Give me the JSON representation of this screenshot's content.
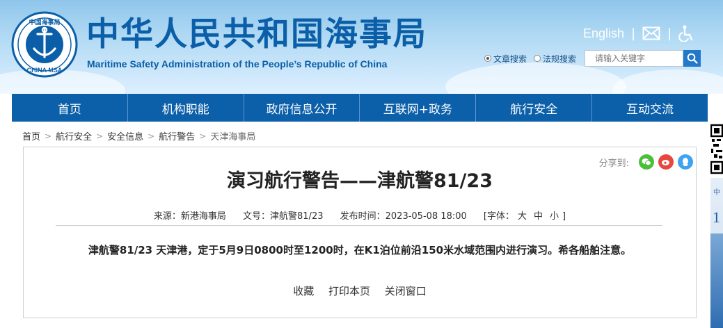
{
  "header": {
    "emblem_top_text": "中国海事局",
    "emblem_bottom_text": "CHINA MSA",
    "title": "中华人民共和国海事局",
    "subtitle": "Maritime Safety Administration of the People’s Republic of China",
    "english_link": "English",
    "icons": [
      "mail-icon",
      "accessibility-icon"
    ],
    "search": {
      "options": [
        {
          "label": "文章搜索",
          "selected": true
        },
        {
          "label": "法规搜索",
          "selected": false
        }
      ],
      "placeholder": "请输入关键字"
    }
  },
  "nav": {
    "items": [
      "首页",
      "机构职能",
      "政府信息公开",
      "互联网+政务",
      "航行安全",
      "互动交流"
    ]
  },
  "breadcrumb": [
    "首页",
    "航行安全",
    "安全信息",
    "航行警告",
    "天津海事局"
  ],
  "article": {
    "share_label": "分享到:",
    "share_icons": [
      "wechat-icon",
      "weibo-icon",
      "qq-icon"
    ],
    "title": "演习航行警告——津航警81/23",
    "source": "来源：新港海事局",
    "doc_no": "文号：津航警81/23",
    "published": "发布时间：2023-05-08 18:00",
    "font_size_label": "[字体：",
    "font_sizes": [
      "大",
      "中",
      "小"
    ],
    "font_size_close": "]",
    "body": "津航警81/23 天津港，定于5月9日0800时至1200时，在K1泊位前沿150米水域范围内进行演习。希各船舶注意。",
    "actions": [
      "收藏",
      "打印本页",
      "关闭窗口"
    ]
  },
  "side": {
    "text_a": "中",
    "text_b": "1"
  },
  "colors": {
    "brand_blue": "#0c5fa9",
    "title_blue": "#0b5fa8",
    "wechat": "#4cbf3a",
    "weibo": "#e8473f",
    "qq": "#3ea4f2"
  }
}
